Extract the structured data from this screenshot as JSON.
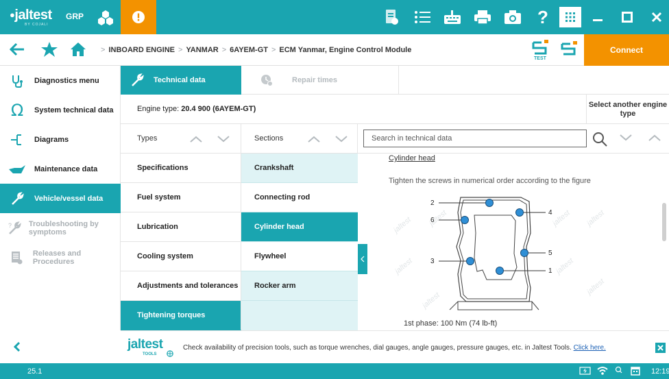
{
  "app": {
    "logo_text": "jaltest",
    "logo_sub": "BY COJALI",
    "mode_label": "GRP",
    "connect_label": "Connect"
  },
  "breadcrumb": [
    "INBOARD ENGINE",
    "YANMAR",
    "6AYEM-GT",
    "ECM Yanmar, Engine Control Module"
  ],
  "toolbar_icons": [
    "report-icon",
    "list-icon",
    "keyboard-icon",
    "print-icon",
    "camera-icon",
    "help-icon",
    "apps-grid-icon"
  ],
  "sidebar": {
    "items": [
      {
        "label": "Diagnostics menu",
        "icon": "stethoscope-icon"
      },
      {
        "label": "System technical data",
        "icon": "omega-icon"
      },
      {
        "label": "Diagrams",
        "icon": "diagram-icon"
      },
      {
        "label": "Maintenance data",
        "icon": "oil-can-icon"
      },
      {
        "label": "Vehicle/vessel data",
        "icon": "wrench-icon"
      },
      {
        "label": "Troubleshooting by symptoms",
        "icon": "troubleshoot-icon"
      },
      {
        "label": "Releases and Procedures",
        "icon": "document-icon"
      }
    ]
  },
  "tabs": {
    "technical": "Technical data",
    "repair": "Repair times"
  },
  "engine": {
    "label": "Engine type:",
    "value": "20.4 900 (6AYEM-GT)",
    "select_another": "Select another engine type"
  },
  "types": {
    "header": "Types",
    "items": [
      "Specifications",
      "Fuel system",
      "Lubrication",
      "Cooling system",
      "Adjustments and tolerances",
      "Tightening torques"
    ]
  },
  "sections": {
    "header": "Sections",
    "items": [
      "Crankshaft",
      "Connecting rod",
      "Cylinder head",
      "Flywheel",
      "Rocker arm"
    ]
  },
  "search": {
    "placeholder": "Search in technical data"
  },
  "content": {
    "title": "Cylinder head",
    "instruction": "Tighten the screws in numerical order according to the figure",
    "figure_labels": [
      "2",
      "6",
      "4",
      "3",
      "5",
      "1"
    ],
    "watermark": "jaltest",
    "phase": "1st phase: 100 Nm (74 lb-ft)"
  },
  "banner": {
    "logo_text": "jaltest",
    "logo_sub": "TOOLS",
    "message": "Check availability of precision tools, such as torque wrenches, dial gauges, angle gauges, pressure gauges, etc. in Jaltest Tools.",
    "link": "Click here."
  },
  "status": {
    "version": "25.1",
    "time": "12:19"
  },
  "colors": {
    "teal": "#1aa5b0",
    "orange": "#f39200",
    "light_teal": "#dff3f5",
    "screw_blue": "#2f8fd6"
  }
}
